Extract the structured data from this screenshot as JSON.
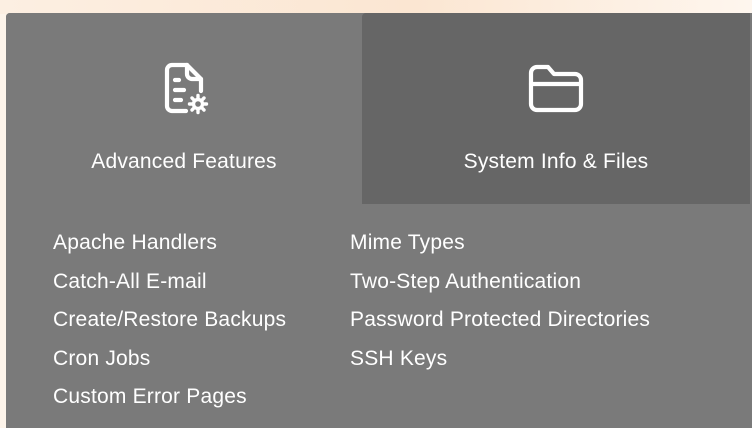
{
  "tabs": [
    {
      "label": "Advanced Features",
      "icon": "document-gear-icon",
      "active": true
    },
    {
      "label": "System Info & Files",
      "icon": "folder-icon",
      "active": false
    }
  ],
  "links": {
    "column1": [
      "Apache Handlers",
      "Catch-All E-mail",
      "Create/Restore Backups",
      "Cron Jobs",
      "Custom Error Pages"
    ],
    "column2": [
      "Mime Types",
      "Two-Step Authentication",
      "Password Protected Directories",
      "SSH Keys"
    ]
  },
  "colors": {
    "active_tab": "#7a7a7a",
    "inactive_tab": "#666666",
    "text": "#ffffff",
    "background": "#fdf4ea"
  }
}
